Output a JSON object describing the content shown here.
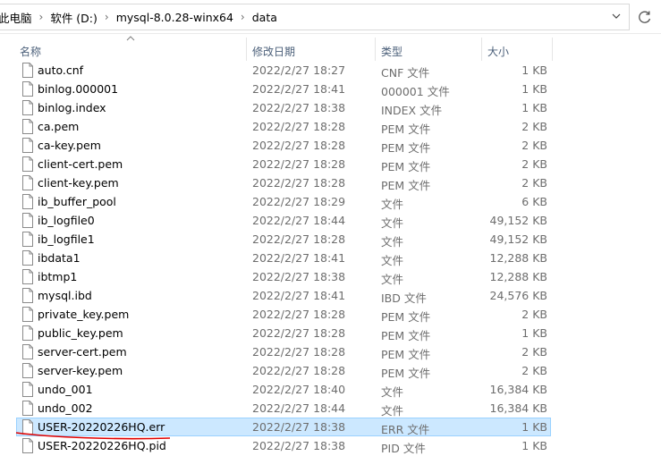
{
  "breadcrumb": {
    "items": [
      "此电脑",
      "软件 (D:)",
      "mysql-8.0.28-winx64",
      "data"
    ]
  },
  "columns": {
    "name": "名称",
    "date": "修改日期",
    "type": "类型",
    "size": "大小"
  },
  "files": [
    {
      "name": "auto.cnf",
      "date": "2022/2/27 18:27",
      "type": "CNF 文件",
      "size": "1 KB"
    },
    {
      "name": "binlog.000001",
      "date": "2022/2/27 18:41",
      "type": "000001 文件",
      "size": "1 KB"
    },
    {
      "name": "binlog.index",
      "date": "2022/2/27 18:38",
      "type": "INDEX 文件",
      "size": "1 KB"
    },
    {
      "name": "ca.pem",
      "date": "2022/2/27 18:28",
      "type": "PEM 文件",
      "size": "2 KB"
    },
    {
      "name": "ca-key.pem",
      "date": "2022/2/27 18:28",
      "type": "PEM 文件",
      "size": "2 KB"
    },
    {
      "name": "client-cert.pem",
      "date": "2022/2/27 18:28",
      "type": "PEM 文件",
      "size": "2 KB"
    },
    {
      "name": "client-key.pem",
      "date": "2022/2/27 18:28",
      "type": "PEM 文件",
      "size": "2 KB"
    },
    {
      "name": "ib_buffer_pool",
      "date": "2022/2/27 18:29",
      "type": "文件",
      "size": "6 KB"
    },
    {
      "name": "ib_logfile0",
      "date": "2022/2/27 18:44",
      "type": "文件",
      "size": "49,152 KB"
    },
    {
      "name": "ib_logfile1",
      "date": "2022/2/27 18:28",
      "type": "文件",
      "size": "49,152 KB"
    },
    {
      "name": "ibdata1",
      "date": "2022/2/27 18:41",
      "type": "文件",
      "size": "12,288 KB"
    },
    {
      "name": "ibtmp1",
      "date": "2022/2/27 18:38",
      "type": "文件",
      "size": "12,288 KB"
    },
    {
      "name": "mysql.ibd",
      "date": "2022/2/27 18:41",
      "type": "IBD 文件",
      "size": "24,576 KB"
    },
    {
      "name": "private_key.pem",
      "date": "2022/2/27 18:28",
      "type": "PEM 文件",
      "size": "2 KB"
    },
    {
      "name": "public_key.pem",
      "date": "2022/2/27 18:28",
      "type": "PEM 文件",
      "size": "1 KB"
    },
    {
      "name": "server-cert.pem",
      "date": "2022/2/27 18:28",
      "type": "PEM 文件",
      "size": "2 KB"
    },
    {
      "name": "server-key.pem",
      "date": "2022/2/27 18:28",
      "type": "PEM 文件",
      "size": "2 KB"
    },
    {
      "name": "undo_001",
      "date": "2022/2/27 18:40",
      "type": "文件",
      "size": "16,384 KB"
    },
    {
      "name": "undo_002",
      "date": "2022/2/27 18:44",
      "type": "文件",
      "size": "16,384 KB"
    },
    {
      "name": "USER-20220226HQ.err",
      "date": "2022/2/27 18:38",
      "type": "ERR 文件",
      "size": "1 KB",
      "selected": true
    },
    {
      "name": "USER-20220226HQ.pid",
      "date": "2022/2/27 18:38",
      "type": "PID 文件",
      "size": "1 KB"
    }
  ],
  "icons": {
    "file": "file-icon",
    "dropdown": "chevron-down-icon",
    "refresh": "refresh-icon",
    "sort": "sort-up-icon"
  },
  "colors": {
    "selection_bg": "#cce8ff",
    "selection_border": "#99d1ff",
    "header_text": "#4c607a",
    "annotation": "#e00000"
  }
}
